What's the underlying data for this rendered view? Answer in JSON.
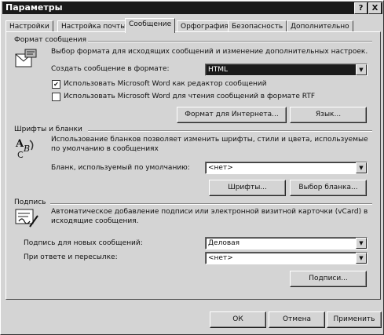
{
  "window": {
    "title": "Параметры",
    "help_label": "?",
    "close_label": "X"
  },
  "tabs": [
    {
      "label": "Настройки"
    },
    {
      "label": "Настройка почты"
    },
    {
      "label": "Сообщение"
    },
    {
      "label": "Орфография"
    },
    {
      "label": "Безопасность"
    },
    {
      "label": "Дополнительно"
    }
  ],
  "format_section": {
    "title": "Формат сообщения",
    "description": "Выбор формата для исходящих сообщений и изменение дополнительных настроек.",
    "create_label": "Создать сообщение в формате:",
    "create_value": "HTML",
    "checkbox_word_editor": {
      "label": "Использовать Microsoft Word как редактор сообщений",
      "checked": true
    },
    "checkbox_word_rtf": {
      "label": "Использовать Microsoft Word для чтения сообщений в формате RTF",
      "checked": false
    },
    "internet_button": "Формат для Интернета...",
    "language_button": "Язык..."
  },
  "fonts_section": {
    "title": "Шрифты и бланки",
    "description_line1": "Использование бланков позволяет изменить шрифты, стили и цвета, используемые",
    "description_line2": "по умолчанию в сообщениях",
    "default_label": "Бланк, используемый по умолчанию:",
    "default_value": "<нет>",
    "fonts_button": "Шрифты...",
    "choose_button": "Выбор бланка..."
  },
  "signature_section": {
    "title": "Подпись",
    "description_line1": "Автоматическое добавление подписи или электронной визитной карточки (vCard) в",
    "description_line2": "исходящие сообщения.",
    "new_label": "Подпись для новых сообщений:",
    "new_value": "Деловая",
    "reply_label": "При ответе и пересылке:",
    "reply_value": "<нет>",
    "signatures_button": "Подписи..."
  },
  "footer": {
    "ok": "ОК",
    "cancel": "Отмена",
    "apply": "Применить"
  }
}
